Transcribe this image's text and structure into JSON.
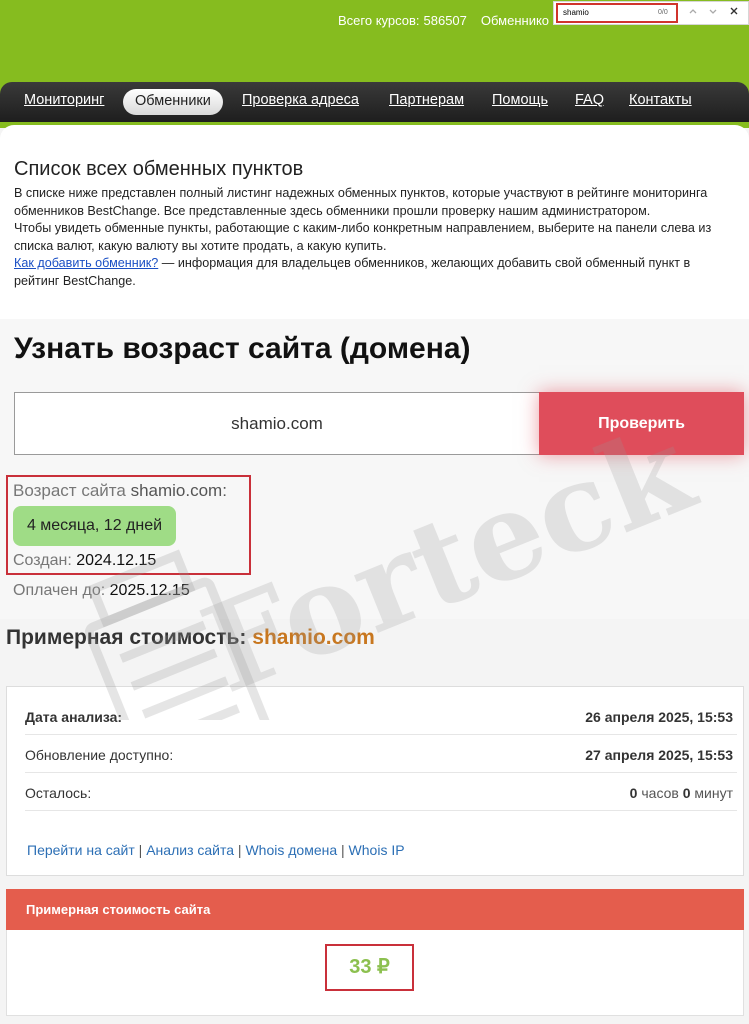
{
  "header": {
    "rates_label": "Всего курсов:",
    "rates_count": "586507",
    "exchangers_label": "Обменнико"
  },
  "findbar": {
    "query": "shamio",
    "count": "0/0"
  },
  "nav": {
    "items": [
      "Мониторинг",
      "Обменники",
      "Проверка адреса",
      "Партнерам",
      "Помощь",
      "FAQ",
      "Контакты"
    ],
    "active": "Обменники"
  },
  "list": {
    "title": "Список всех обменных пунктов",
    "p1": "В списке ниже представлен полный листинг надежных обменных пунктов, которые участвуют в рейтинге мониторинга обменников BestChange. Все представленные здесь обменники прошли проверку нашим администратором.",
    "p2": "Чтобы увидеть обменные пункты, работающие с каким-либо конкретным направлением, выберите на панели слева из списка валют, какую валюту вы хотите продать, а какую купить.",
    "link": "Как добавить обменник?",
    "p3": " — информация для владельцев обменников, желающих добавить свой обменный пункт в рейтинг BestChange."
  },
  "age": {
    "title": "Узнать возраст сайта (домена)",
    "input_value": "shamio.com",
    "check_button": "Проверить",
    "age_label": "Возраст сайта",
    "age_domain": "shamio.com:",
    "age_value": "4 месяца, 12 дней",
    "created_label": "Создан:",
    "created_value": "2024.12.15",
    "paid_label": "Оплачен до:",
    "paid_value": "2025.12.15"
  },
  "cost": {
    "heading": "Примерная стоимость:",
    "domain": "shamio.com"
  },
  "analysis": {
    "rows": [
      {
        "label": "Дата анализа:",
        "value": "26 апреля 2025, 15:53"
      },
      {
        "label": "Обновление доступно:",
        "value": "27 апреля 2025, 15:53"
      },
      {
        "label": "Осталось:",
        "hours": "0",
        "hours_unit": "часов",
        "minutes": "0",
        "minutes_unit": "минут"
      }
    ],
    "links": [
      "Перейти на сайт",
      "Анализ сайта",
      "Whois домена",
      "Whois IP"
    ]
  },
  "value": {
    "header": "Примерная стоимость сайта",
    "amount": "33 ₽"
  },
  "watermark": {
    "text": "Forteck"
  }
}
